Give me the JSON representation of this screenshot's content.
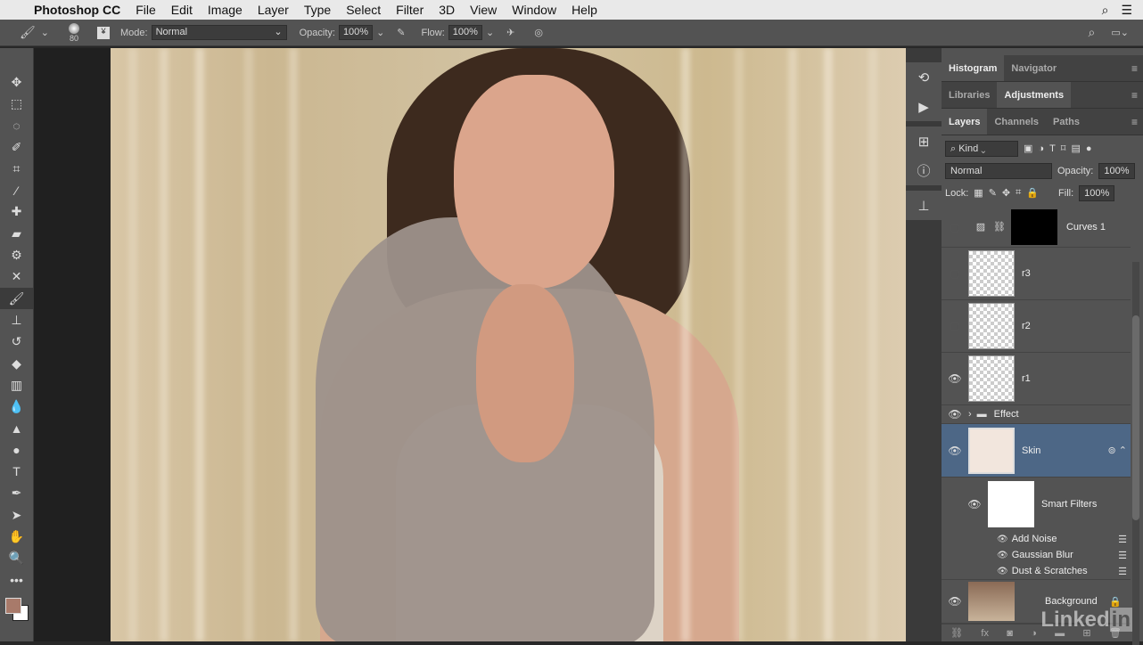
{
  "menubar": {
    "app": "Photoshop CC",
    "items": [
      "File",
      "Edit",
      "Image",
      "Layer",
      "Type",
      "Select",
      "Filter",
      "3D",
      "View",
      "Window",
      "Help"
    ]
  },
  "options": {
    "brush_size": "80",
    "mode_label": "Mode:",
    "mode": "Normal",
    "opacity_label": "Opacity:",
    "opacity": "100%",
    "flow_label": "Flow:",
    "flow": "100%"
  },
  "tools": [
    "move",
    "marquee",
    "lasso",
    "quick-select",
    "crop",
    "eyedropper",
    "healing",
    "brush-heal",
    "patch",
    "content-move",
    "brush",
    "stamp",
    "history-brush",
    "eraser",
    "gradient",
    "blur",
    "dodge",
    "sponge",
    "type",
    "pen",
    "path-select",
    "hand",
    "zoom",
    "more"
  ],
  "colors": {
    "foreground": "#a87a6a",
    "background": "#ffffff",
    "selection": "#4d6786"
  },
  "panels": {
    "row1": [
      "Histogram",
      "Navigator"
    ],
    "row1_active": 0,
    "row2": [
      "Libraries",
      "Adjustments"
    ],
    "row2_active": 1,
    "row3": [
      "Layers",
      "Channels",
      "Paths"
    ],
    "row3_active": 0,
    "filter": "Kind",
    "blend": "Normal",
    "opacity_label": "Opacity:",
    "opacity": "100%",
    "lock_label": "Lock:",
    "fill_label": "Fill:",
    "fill": "100%"
  },
  "layers": [
    {
      "name": "Curves 1",
      "visible": false,
      "type": "adjustment"
    },
    {
      "name": "r3",
      "visible": false,
      "type": "pixel"
    },
    {
      "name": "r2",
      "visible": false,
      "type": "pixel"
    },
    {
      "name": "r1",
      "visible": true,
      "type": "pixel"
    },
    {
      "name": "Effect",
      "visible": true,
      "type": "group"
    },
    {
      "name": "Skin",
      "visible": true,
      "type": "smart",
      "selected": true
    },
    {
      "name": "Smart Filters",
      "visible": true,
      "type": "smart-filters"
    },
    {
      "name": "Add Noise",
      "visible": true,
      "type": "filter"
    },
    {
      "name": "Gaussian Blur",
      "visible": true,
      "type": "filter"
    },
    {
      "name": "Dust & Scratches",
      "visible": true,
      "type": "filter"
    },
    {
      "name": "Background",
      "visible": true,
      "type": "background",
      "locked": true
    }
  ],
  "watermark": "Linkedin"
}
